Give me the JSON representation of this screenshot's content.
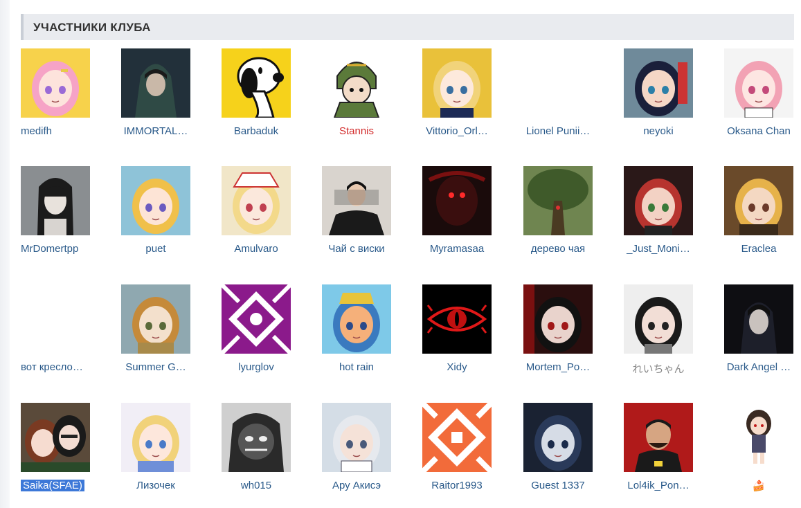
{
  "club": {
    "title": "УЧАСТНИКИ КЛУБА"
  },
  "members": [
    {
      "name": "medifh",
      "avatar": "pink-hair-anime-girl"
    },
    {
      "name": "IMMORTAL…",
      "avatar": "hooded-figure"
    },
    {
      "name": "Barbaduk",
      "avatar": "snoopy-dog"
    },
    {
      "name": "Stannis",
      "avatar": "helmeted-soldier",
      "color": "#d22b2b"
    },
    {
      "name": "Vittorio_Orl…",
      "avatar": "blonde-anime-girl"
    },
    {
      "name": "Lionel Punii…",
      "avatar": "none"
    },
    {
      "name": "neyoki",
      "avatar": "dark-hair-anime-girl"
    },
    {
      "name": "Oksana Chan",
      "avatar": "pink-maid-girl"
    },
    {
      "name": "MrDomertpp",
      "avatar": "long-hair-ink-man"
    },
    {
      "name": "puet",
      "avatar": "blonde-anime-girl-2"
    },
    {
      "name": "Amulvaro",
      "avatar": "blonde-hat-girl"
    },
    {
      "name": "Чай с виски",
      "avatar": "suited-man"
    },
    {
      "name": "Myramasaa",
      "avatar": "red-eyed-dark"
    },
    {
      "name": "дерево чая",
      "avatar": "old-tree"
    },
    {
      "name": "_Just_Moni…",
      "avatar": "red-hair-girl"
    },
    {
      "name": "Eraclea",
      "avatar": "blonde-warrior"
    },
    {
      "name": "вот кресло…",
      "avatar": "none"
    },
    {
      "name": "Summer G…",
      "avatar": "brown-hair-boy"
    },
    {
      "name": "lyurglov",
      "avatar": "purple-identicon"
    },
    {
      "name": "hot rain",
      "avatar": "cartoon-kid"
    },
    {
      "name": "Xidy",
      "avatar": "red-eye-symbol"
    },
    {
      "name": "Mortem_Po…",
      "avatar": "dark-red-girl"
    },
    {
      "name": "れいちゃん",
      "avatar": "long-black-hair-girl",
      "color": "#888888"
    },
    {
      "name": "Dark Angel …",
      "avatar": "dark-portrait"
    },
    {
      "name": "Saika(SFAE)",
      "avatar": "two-anime-girls",
      "selected": true
    },
    {
      "name": "Лизочек",
      "avatar": "alice-anime-girl"
    },
    {
      "name": "wh015",
      "avatar": "monochrome-monster"
    },
    {
      "name": "Ару Акисэ",
      "avatar": "white-hair-anime-boy"
    },
    {
      "name": "Raitor1993",
      "avatar": "orange-identicon"
    },
    {
      "name": "Guest 1337",
      "avatar": "dark-blue-portrait"
    },
    {
      "name": "Lol4ik_Pon…",
      "avatar": "esports-player"
    },
    {
      "name": "🍰",
      "avatar": "chibi-girl"
    }
  ]
}
